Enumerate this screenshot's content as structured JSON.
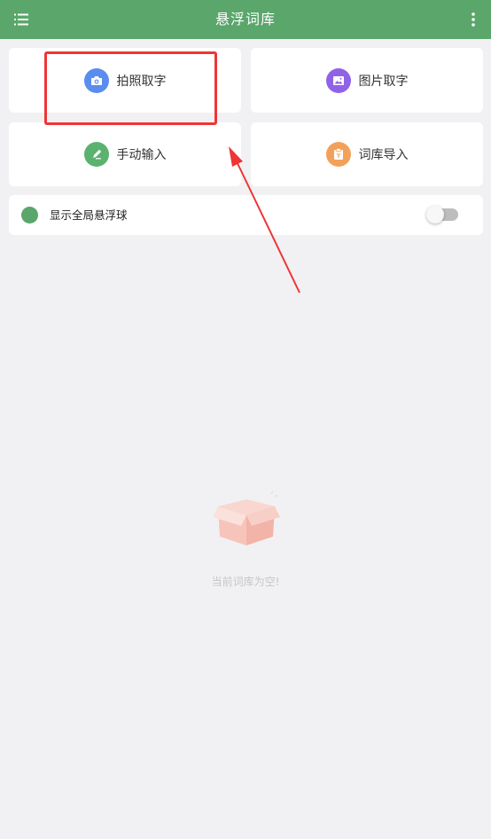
{
  "header": {
    "title": "悬浮词库",
    "menu_icon": "list-icon",
    "more_icon": "more-vertical-icon",
    "color": "#5aa66b"
  },
  "actions": [
    {
      "label": "拍照取字",
      "icon": "camera-icon",
      "color": "#5b8dee"
    },
    {
      "label": "图片取字",
      "icon": "image-icon",
      "color": "#9062e8"
    },
    {
      "label": "手动输入",
      "icon": "pen-icon",
      "color": "#5ab26e"
    },
    {
      "label": "词库导入",
      "icon": "clipboard-icon",
      "color": "#f3a15a"
    }
  ],
  "floating_ball": {
    "label": "显示全局悬浮球",
    "enabled": false,
    "dot_color": "#5aa66b"
  },
  "annotation": {
    "color": "#ef3535"
  },
  "empty_state": {
    "icon": "empty-box-icon",
    "text": "当前词库为空!"
  }
}
